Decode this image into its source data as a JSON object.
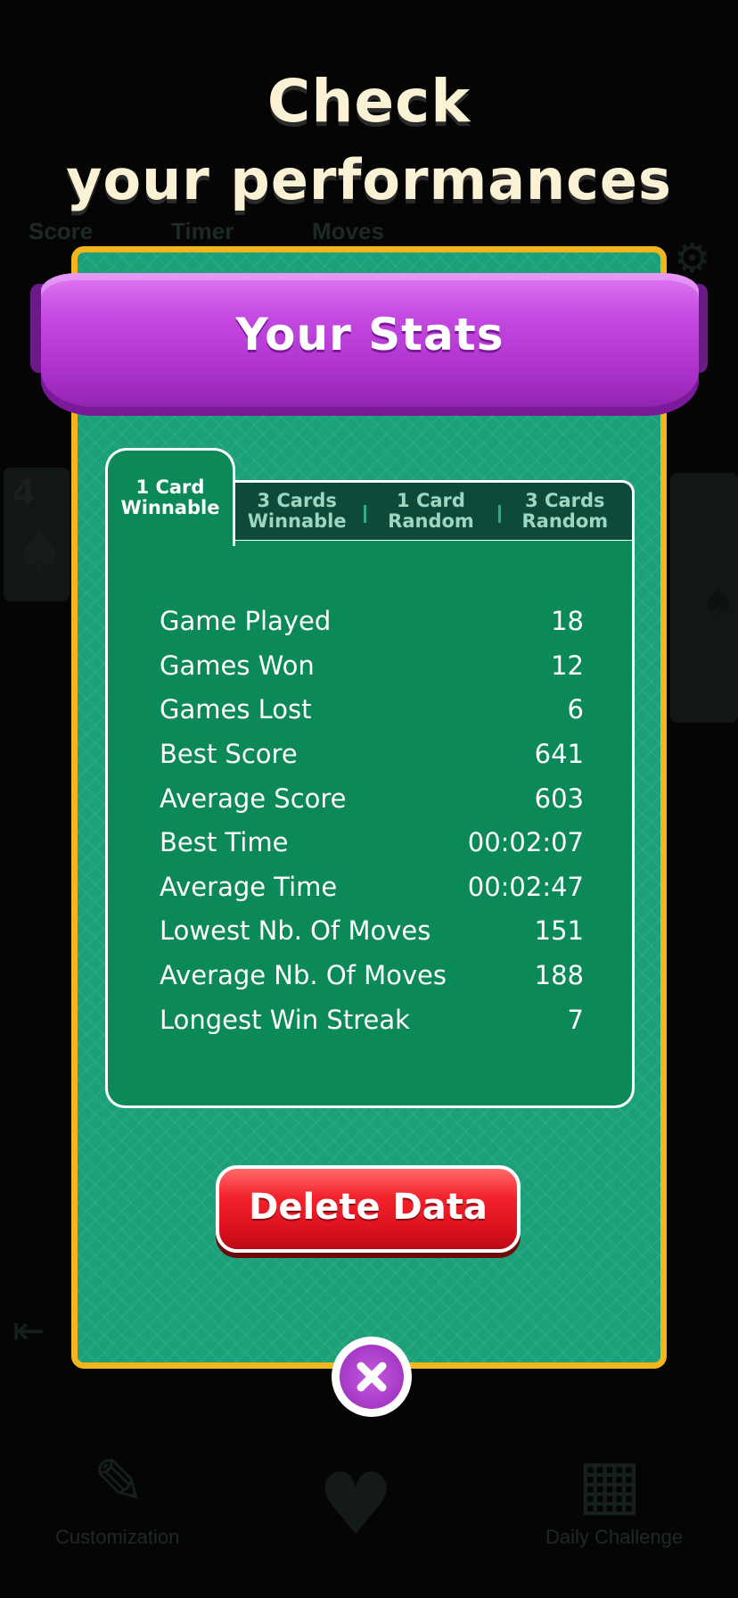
{
  "headline": {
    "line1": "Check",
    "line2": "your performances"
  },
  "background": {
    "score_label": "Score",
    "timer_label": "Timer",
    "moves_label": "Moves",
    "card_rank": "4",
    "customization_label": "Customization",
    "daily_challenge_label": "Daily Challenge"
  },
  "dialog": {
    "title": "Your Stats",
    "tabs": [
      {
        "label": "1 Card\nWinnable",
        "active": true
      },
      {
        "label": "3 Cards\nWinnable",
        "active": false
      },
      {
        "label": "1 Card\nRandom",
        "active": false
      },
      {
        "label": "3 Cards\nRandom",
        "active": false
      }
    ],
    "stats": [
      {
        "label": "Game Played",
        "value": "18"
      },
      {
        "label": "Games Won",
        "value": "12"
      },
      {
        "label": "Games Lost",
        "value": "6"
      },
      {
        "label": "Best Score",
        "value": "641"
      },
      {
        "label": "Average Score",
        "value": "603"
      },
      {
        "label": "Best Time",
        "value": "00:02:07"
      },
      {
        "label": "Average Time",
        "value": "00:02:47"
      },
      {
        "label": "Lowest Nb. Of Moves",
        "value": "151"
      },
      {
        "label": "Average Nb. Of Moves",
        "value": "188"
      },
      {
        "label": "Longest Win Streak",
        "value": "7"
      }
    ],
    "delete_label": "Delete Data",
    "close_icon": "close-icon"
  },
  "colors": {
    "panel_green": "#1ba07a",
    "stats_green": "#0b8a58",
    "border_gold": "#f2b51d",
    "ribbon_purple": "#b53ad6",
    "delete_red": "#e0141f"
  }
}
